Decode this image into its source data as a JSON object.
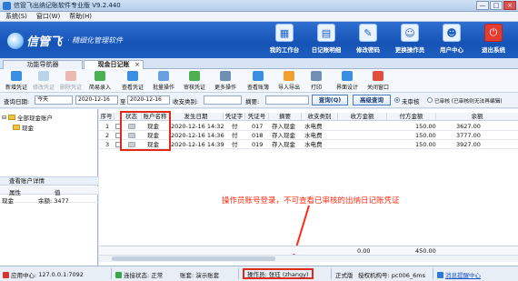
{
  "window": {
    "title": "信管飞出纳记账软件专业版 V9.2.440",
    "min": "—",
    "max": "□",
    "close": "×"
  },
  "menu": [
    "系统(S)",
    "窗口(W)",
    "帮助(H)"
  ],
  "brand": {
    "name": "信管飞",
    "slogan": "· 精细化管理软件"
  },
  "nav": [
    {
      "label": "我的工作台",
      "icon": "desktop-icon",
      "glyph": "▦"
    },
    {
      "label": "日记账明细",
      "icon": "ledger-icon",
      "glyph": "▤"
    },
    {
      "label": "修改密码",
      "icon": "key-icon",
      "glyph": "✎"
    },
    {
      "label": "更换操作员",
      "icon": "user-switch-icon",
      "glyph": "☺"
    },
    {
      "label": "用户中心",
      "icon": "user-center-icon",
      "glyph": "☻"
    },
    {
      "label": "退出系统",
      "icon": "power-icon",
      "glyph": "⏻"
    }
  ],
  "tabs": [
    {
      "label": "功能导航器"
    },
    {
      "label": "现金日记账",
      "close": "×"
    }
  ],
  "toolbar": [
    {
      "label": "新增凭证",
      "color": "#3a8de0"
    },
    {
      "label": "修改凭证",
      "color": "#7aa6d6",
      "disabled": true
    },
    {
      "label": "删除凭证",
      "color": "#e06a5a",
      "disabled": true
    },
    {
      "label": "简易录入",
      "color": "#4caf50"
    },
    {
      "label": "查看凭证",
      "color": "#3a8de0"
    },
    {
      "label": "批量操作",
      "color": "#6aa0e0"
    },
    {
      "label": "审核凭证",
      "color": "#4caf50"
    },
    {
      "label": "更多操作",
      "color": "#6f8fb5"
    },
    {
      "label": "查看账簿",
      "color": "#3a8de0"
    },
    {
      "label": "导入导出",
      "color": "#f0a030"
    },
    {
      "label": "打印",
      "color": "#6f8fb5"
    },
    {
      "label": "界面设计",
      "color": "#3a8de0"
    },
    {
      "label": "关闭窗口",
      "color": "#e05040"
    }
  ],
  "filter": {
    "date_label": "查询日期:",
    "date_value": "今天",
    "from": "2020-12-16",
    "to_label": "至",
    "to": "2020-12-16",
    "category_label": "收支类别:",
    "category_value": "",
    "summary_label": "摘要:",
    "summary_value": "",
    "query_button": "查询(Q)",
    "advanced_button": "高级查询",
    "radio_unaudited": "未审核",
    "radio_audited": "已审核 (已审核则无法再编辑)"
  },
  "tree": {
    "root": "全部现金账户",
    "child": "现金"
  },
  "details": {
    "title": "查看账户详情",
    "col_attr": "属性",
    "col_value": "值",
    "row_attr": "现金",
    "row_value": "余额: 3477"
  },
  "grid": {
    "columns": [
      "序号",
      "状态",
      "账户名称",
      "发生日期",
      "凭证字",
      "凭证号",
      "摘要",
      "收支类别",
      "收方金额",
      "付方金额",
      "余额"
    ],
    "rows": [
      {
        "no": "1",
        "account": "现金",
        "date": "2020-12-16 14:32",
        "word": "付",
        "num": "017",
        "summary": "存入现金",
        "category": "水电费",
        "debit": "",
        "credit": "150.00",
        "balance": "3627.00"
      },
      {
        "no": "2",
        "account": "现金",
        "date": "2020-12-16 14:36",
        "word": "付",
        "num": "018",
        "summary": "存入现金",
        "category": "水电费",
        "debit": "",
        "credit": "150.00",
        "balance": "3777.00"
      },
      {
        "no": "3",
        "account": "现金",
        "date": "2020-12-16 14:39",
        "word": "付",
        "num": "019",
        "summary": "存入现金",
        "category": "水电费",
        "debit": "",
        "credit": "150.00",
        "balance": "3927.00"
      }
    ],
    "footer_debit": "0.00",
    "footer_credit": "450.00"
  },
  "annotation": "操作员账号登录，不可查看已审核的出纳日记账凭证",
  "status": {
    "app_center": "应用中心:",
    "ip": "127.0.0.1:7092",
    "connection": "连接状态: 正常",
    "ledger": "账套: 演示账套",
    "operator": "操作员: 张珏 (zhangy)",
    "edition": "正式版",
    "license": "授权机构号: pc006_6ms",
    "message": "消息提醒中心"
  },
  "colors": {
    "accent": "#1d5fc0",
    "highlight": "#e02a1c"
  }
}
